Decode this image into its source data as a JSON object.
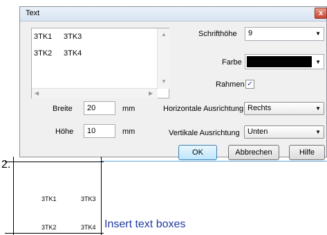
{
  "dialog": {
    "title": "Text",
    "close_glyph": "x",
    "list": {
      "rows": [
        {
          "c1": "3TK1",
          "c2": "3TK3"
        },
        {
          "c1": "3TK2",
          "c2": "3TK4"
        }
      ]
    },
    "fields": {
      "breite_label": "Breite",
      "breite_value": "20",
      "breite_unit": "mm",
      "hoehe_label": "Höhe",
      "hoehe_value": "10",
      "hoehe_unit": "mm"
    },
    "right": {
      "schrifthoehe_label": "Schrifthöhe",
      "schrifthoehe_value": "9",
      "farbe_label": "Farbe",
      "farbe_color": "#000000",
      "rahmen_label": "Rahmen",
      "rahmen_checked": true,
      "h_align_label": "Horizontale Ausrichtung",
      "h_align_value": "Rechts",
      "v_align_label": "Vertikale Ausrichtung",
      "v_align_value": "Unten"
    },
    "buttons": {
      "ok": "OK",
      "cancel": "Abbrechen",
      "help": "Hilfe"
    }
  },
  "illustration": {
    "step_number": "2.",
    "cells": [
      "3TK1",
      "3TK3",
      "3TK2",
      "3TK4"
    ],
    "caption": "Insert text boxes"
  }
}
